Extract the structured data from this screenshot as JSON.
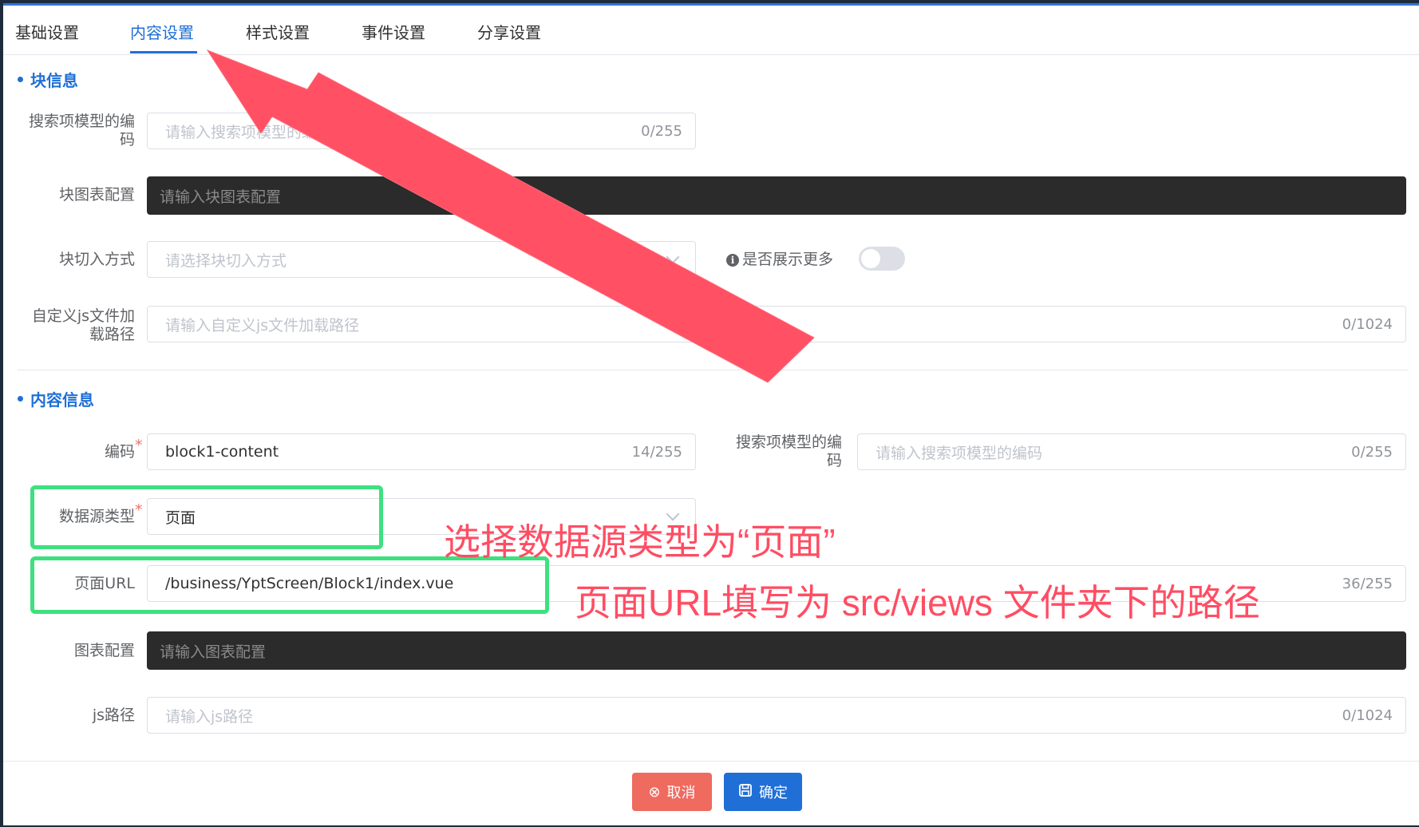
{
  "tabs": [
    {
      "label": "基础设置",
      "active": false
    },
    {
      "label": "内容设置",
      "active": true
    },
    {
      "label": "样式设置",
      "active": false
    },
    {
      "label": "事件设置",
      "active": false
    },
    {
      "label": "分享设置",
      "active": false
    }
  ],
  "block_info": {
    "title": "块信息",
    "search_model_code": {
      "label_line1": "搜索项模型的编",
      "label_line2": "码",
      "placeholder": "请输入搜索项模型的编码",
      "count": "0/255"
    },
    "chart_config": {
      "label": "块图表配置",
      "placeholder": "请输入块图表配置"
    },
    "switch_mode": {
      "label": "块切入方式",
      "placeholder": "请选择块切入方式"
    },
    "show_more": {
      "label": "是否展示更多",
      "info_icon": "i",
      "enabled": false
    },
    "custom_js": {
      "label_line1": "自定义js文件加",
      "label_line2": "载路径",
      "placeholder": "请输入自定义js文件加载路径",
      "count": "0/1024"
    }
  },
  "content_info": {
    "title": "内容信息",
    "code": {
      "label": "编码",
      "value": "block1-content",
      "count": "14/255",
      "required": "*"
    },
    "search_model_code": {
      "label_line1": "搜索项模型的编",
      "label_line2": "码",
      "placeholder": "请输入搜索项模型的编码",
      "count": "0/255"
    },
    "data_source_type": {
      "label": "数据源类型",
      "value": "页面",
      "required": "*"
    },
    "page_url": {
      "label": "页面URL",
      "value": "/business/YptScreen/Block1/index.vue",
      "count": "36/255"
    },
    "chart_config": {
      "label": "图表配置",
      "placeholder": "请输入图表配置"
    },
    "js_path": {
      "label": "js路径",
      "placeholder": "请输入js路径",
      "count": "0/1024"
    }
  },
  "footer": {
    "cancel_label": "取消",
    "cancel_icon": "⊗",
    "ok_label": "确定",
    "ok_icon": "floppy-disk-icon"
  },
  "annotations": {
    "note1": "选择数据源类型为“页面”",
    "note2": "页面URL填写为 src/views 文件夹下的路径",
    "arrow_color": "#ff4d63",
    "box_color": "#3ee07f"
  },
  "colors": {
    "accent": "#1f6fd6",
    "danger": "#ef6a5f",
    "dark_input": "#2b2b2b"
  }
}
